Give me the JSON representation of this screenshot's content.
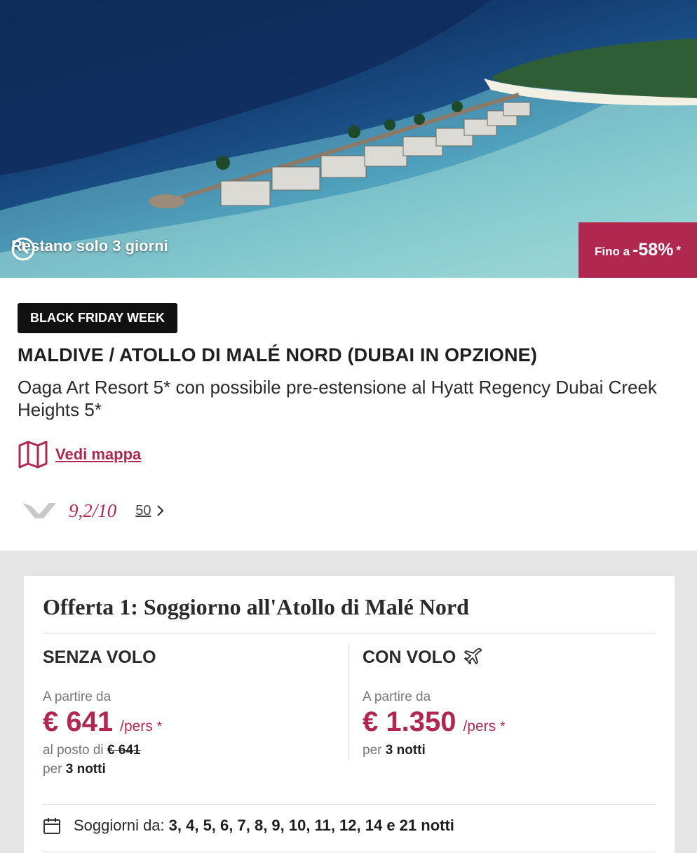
{
  "hero": {
    "timer_text": "Restano solo 3 giorni",
    "discount_prefix": "Fino a",
    "discount_value": "-58%",
    "discount_star": "*"
  },
  "info": {
    "badge": "BLACK FRIDAY WEEK",
    "title": "MALDIVE / ATOLLO DI MALÉ NORD (DUBAI IN OPZIONE)",
    "subtitle": "Oaga Art Resort 5* con possibile pre-estensione al Hyatt Regency Dubai Creek Heights 5*",
    "map_link": "Vedi mappa",
    "rating_score": "9,2/10",
    "rating_count": "50"
  },
  "offer": {
    "title": "Offerta 1: Soggiorno all'Atollo di Malé Nord",
    "without_flight": {
      "heading": "SENZA VOLO",
      "from_label": "A partire da",
      "price": "€ 641",
      "per_person": "/pers",
      "star": "*",
      "instead_label": "al posto di",
      "old_price": "€ 641",
      "nights_prefix": "per",
      "nights": "3 notti"
    },
    "with_flight": {
      "heading": "CON VOLO",
      "from_label": "A partire da",
      "price": "€ 1.350",
      "per_person": "/pers",
      "star": "*",
      "nights_prefix": "per",
      "nights": "3 notti"
    },
    "stays_label": "Soggiorni da:",
    "stays_values": "3, 4, 5, 6, 7, 8, 9, 10, 11, 12, 14 e 21 notti"
  },
  "colors": {
    "accent": "#b0284f",
    "badge_bg": "#111111",
    "section_bg": "#e5e5e5"
  }
}
